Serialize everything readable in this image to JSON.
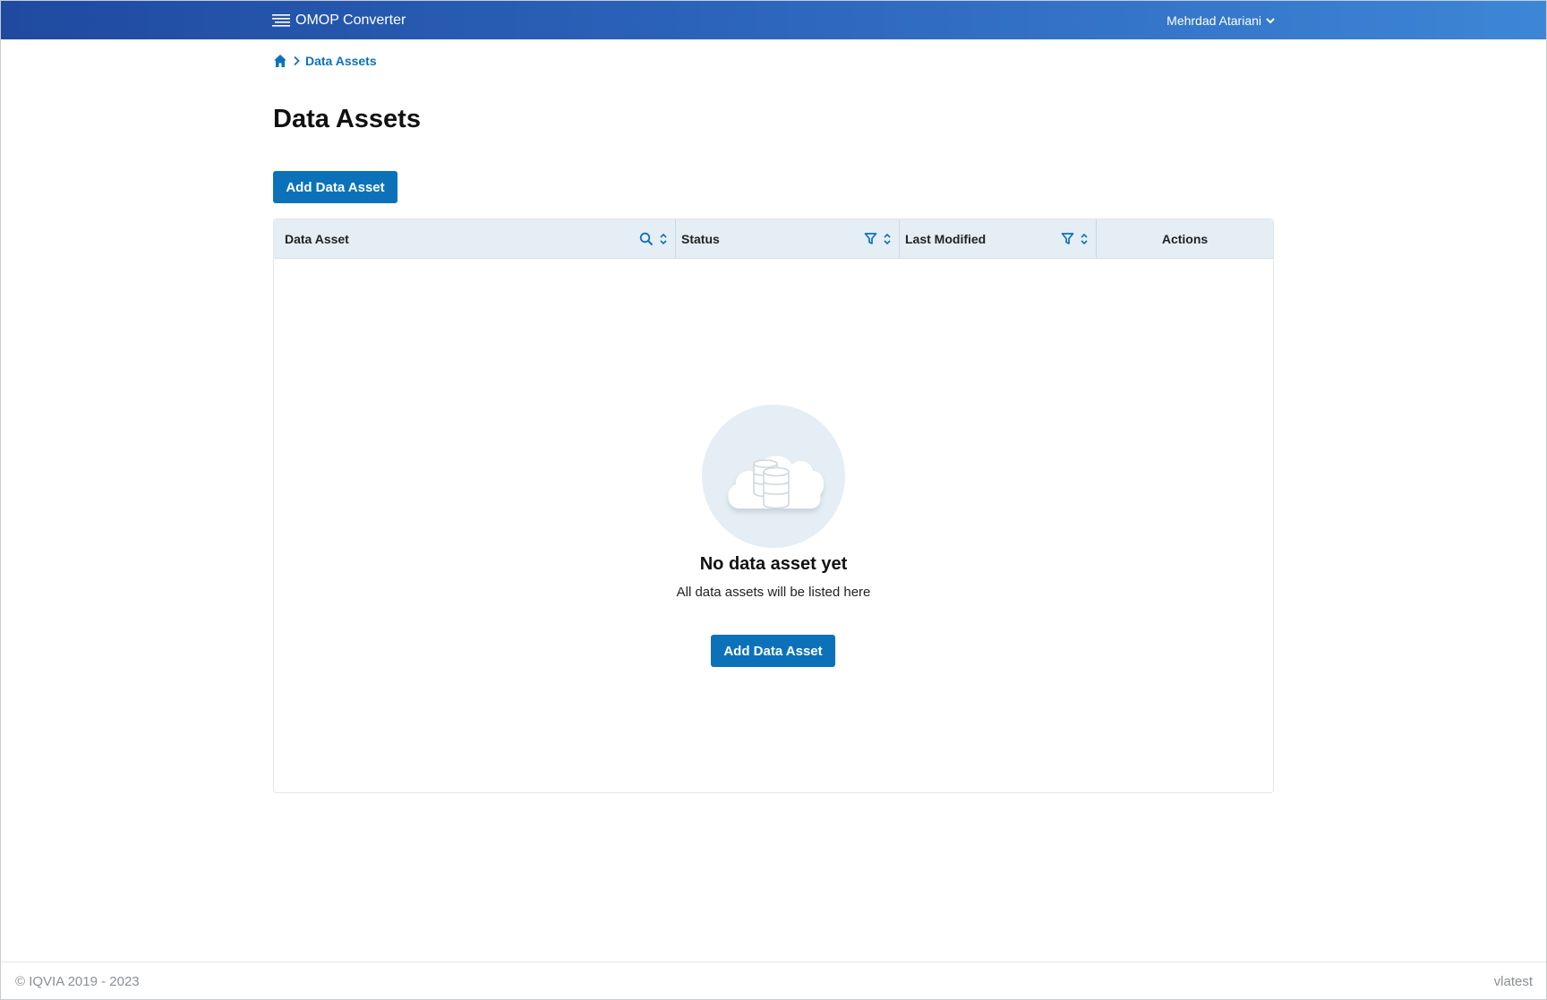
{
  "header": {
    "app_title": "OMOP Converter",
    "app_icon": "menu-lines-icon",
    "user_name": "Mehrdad Atariani",
    "user_menu_icon": "chevron-down-icon"
  },
  "breadcrumb": {
    "home_icon": "home-icon",
    "separator_icon": "chevron-right-icon",
    "current": "Data Assets"
  },
  "page": {
    "title": "Data Assets",
    "add_button_label": "Add Data Asset"
  },
  "table": {
    "columns": [
      {
        "label": "Data Asset",
        "tools": [
          "search-icon",
          "sort-icon"
        ]
      },
      {
        "label": "Status",
        "tools": [
          "filter-icon",
          "sort-icon"
        ]
      },
      {
        "label": "Last Modified",
        "tools": [
          "filter-icon",
          "sort-icon"
        ]
      },
      {
        "label": "Actions",
        "tools": []
      }
    ],
    "rows": [],
    "empty_state": {
      "icon": "cloud-database-icon",
      "title": "No data asset yet",
      "subtitle": "All data assets will be listed here",
      "button_label": "Add Data Asset"
    }
  },
  "footer": {
    "copyright": "© IQVIA 2019 - 2023",
    "version": "vlatest"
  },
  "colors": {
    "primary": "#0b72b9",
    "header_gradient_start": "#1f4aa0",
    "header_gradient_end": "#3d86d6",
    "table_header_bg": "#e4eef4"
  }
}
